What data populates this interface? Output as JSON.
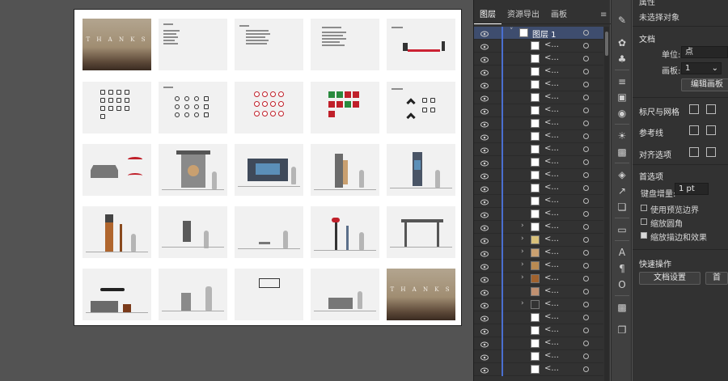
{
  "artboard": {
    "thumb_text_thanks": "T H A N K S"
  },
  "layers_panel": {
    "tabs": [
      "图层",
      "资源导出",
      "画板"
    ],
    "close": "«",
    "menu": "≡",
    "top_layer_name": "图层 1",
    "item_name": "<...",
    "row_count": 27
  },
  "properties": {
    "tabs_partial": "属性",
    "no_selection": "未选择对象",
    "document_section": "文档",
    "units_label": "单位:",
    "units_value": "点",
    "artboard_label": "画板:",
    "artboard_value": "1",
    "edit_artboards_button": "编辑画板",
    "rulers_grids": "标尺与网格",
    "guides": "参考线",
    "snap_options": "对齐选项",
    "preferences": "首选项",
    "keyboard_increment_label": "键盘增量:",
    "keyboard_increment_value": "1 pt",
    "use_preview_bounds": "使用预览边界",
    "scale_corners": "缩放圆角",
    "scale_strokes_effects": "缩放描边和效果",
    "quick_actions": "快速操作",
    "document_setup_button": "文档设置",
    "second_button_partial": "首"
  }
}
